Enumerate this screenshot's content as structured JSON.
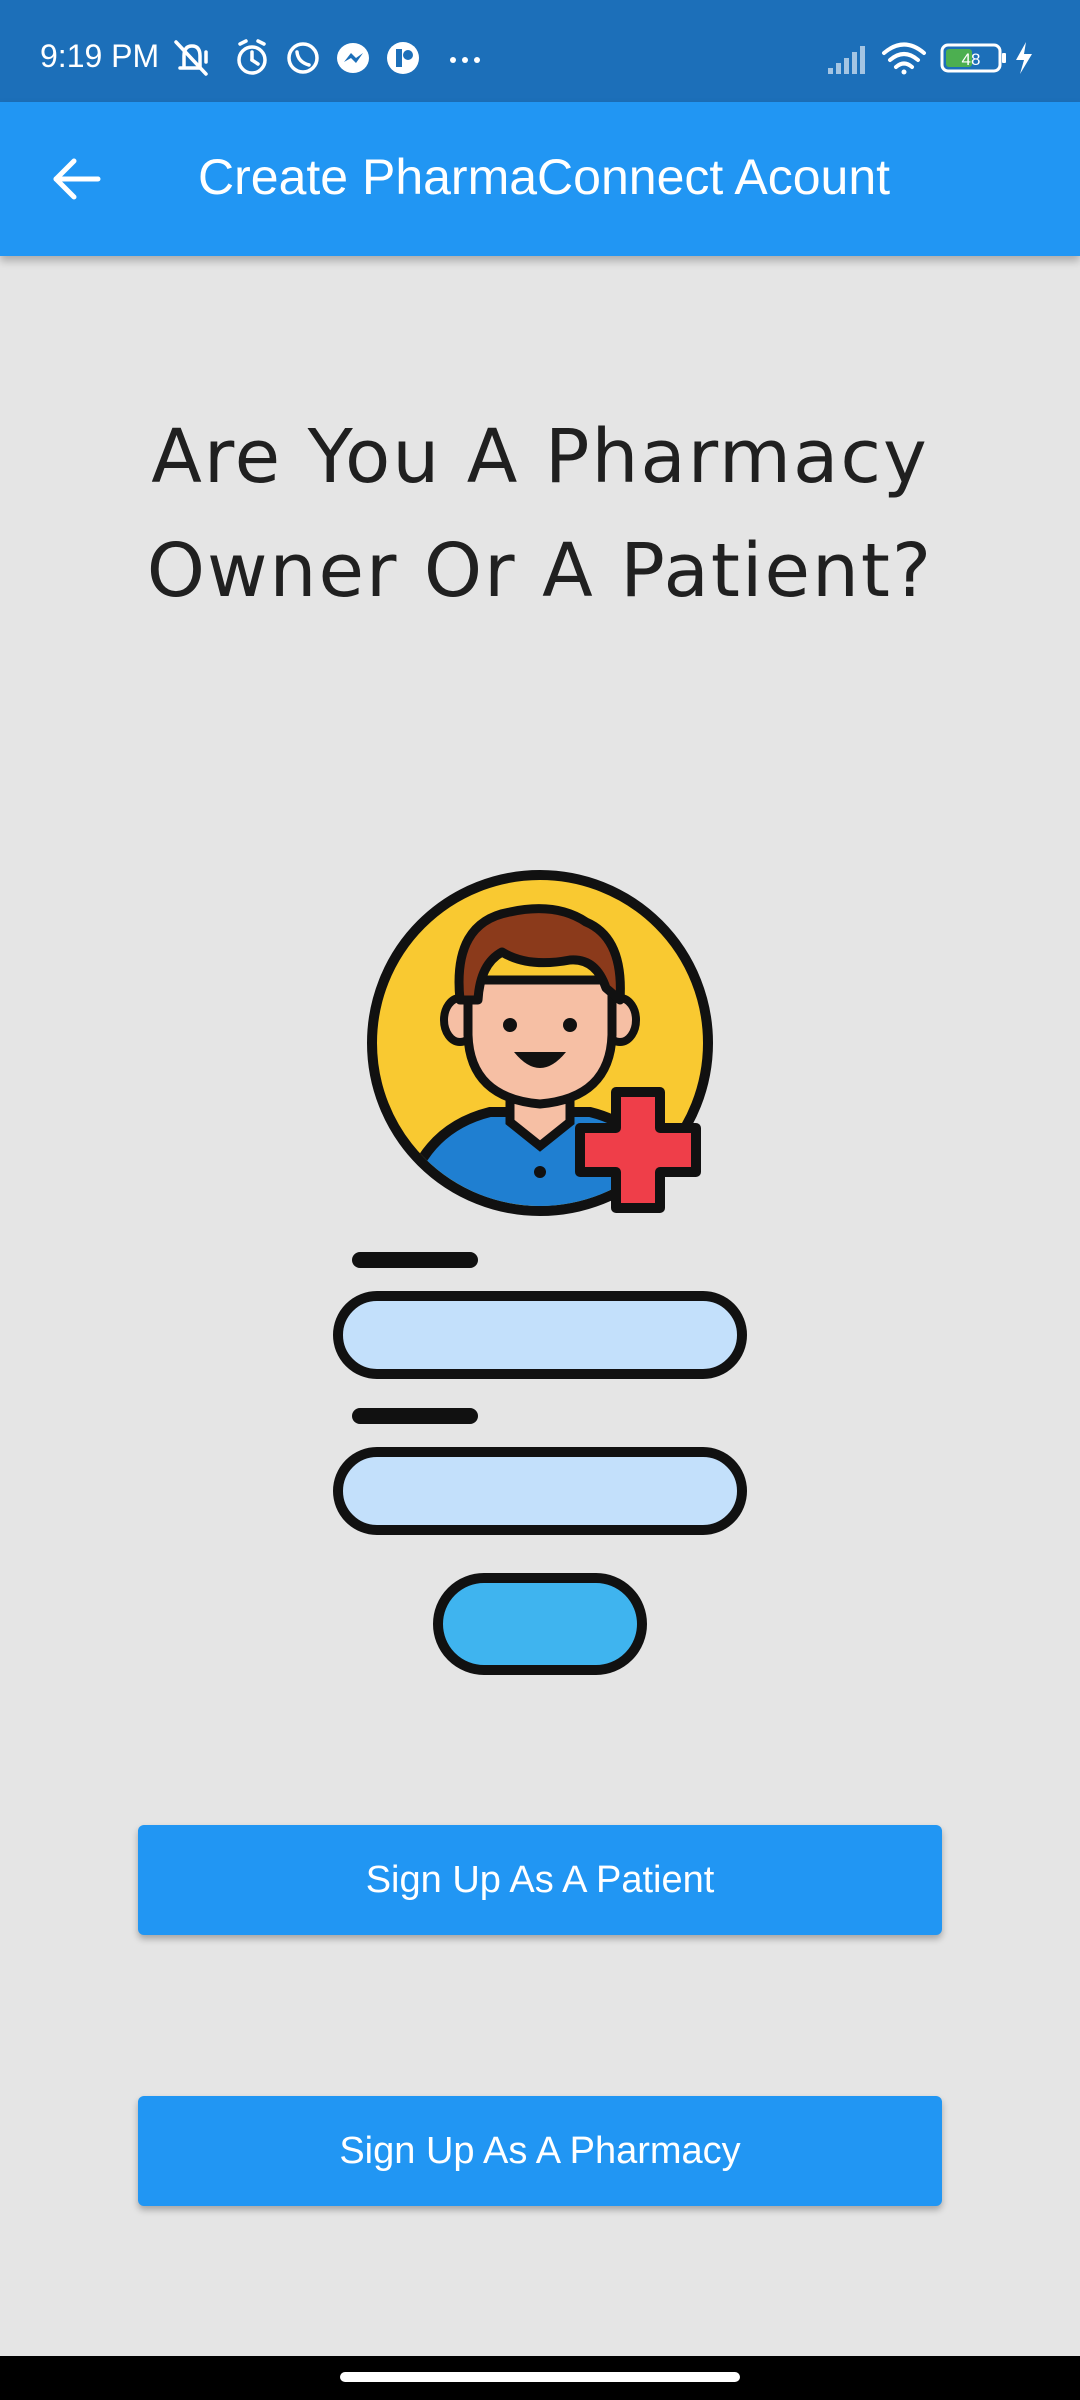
{
  "status_bar": {
    "time": "9:19 PM",
    "battery": "48",
    "left_icons": [
      "mute-icon",
      "alarm-icon",
      "whatsapp-icon",
      "messenger-icon",
      "app-icon",
      "more-dots-icon"
    ],
    "right_icons": [
      "signal-icon",
      "wifi-icon",
      "battery-icon",
      "charging-icon"
    ]
  },
  "app_bar": {
    "title": "Create PharmaConnect Acount",
    "back_icon": "arrow-left-icon"
  },
  "main": {
    "question": "Are You A Pharmacy Owner Or A Patient?",
    "illustration": "patient-registration-illustration"
  },
  "buttons": {
    "patient_label": "Sign Up As A Patient",
    "pharmacy_label": "Sign Up As A Pharmacy"
  },
  "colors": {
    "status_bar": "#1c6fb9",
    "app_bar": "#2196f3",
    "background": "#e5e5e5",
    "button": "#2196f3",
    "text_dark": "#202020"
  }
}
